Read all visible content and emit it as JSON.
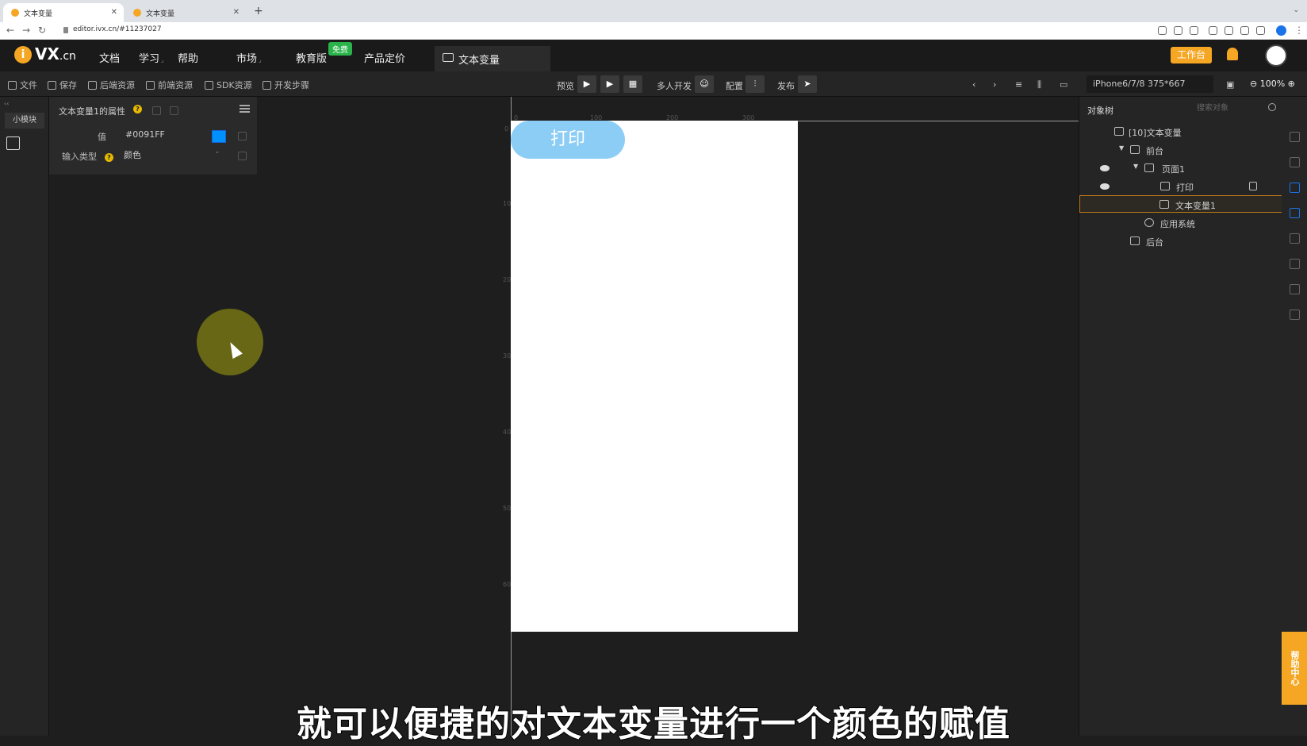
{
  "browser": {
    "tabs": [
      {
        "label": "文本变量"
      },
      {
        "label": "文本变量"
      }
    ],
    "new_tab": "+",
    "url": "editor.ivx.cn/#11237027"
  },
  "app": {
    "logo_i": "i",
    "logo_text": "VX",
    "logo_suffix": ".cn",
    "menu": {
      "docs": "文档",
      "learn": "学习",
      "help": "帮助",
      "market": "市场",
      "edu": "教育版",
      "free_badge": "免费",
      "pricing": "产品定价"
    },
    "doc_tab": "文本变量",
    "workbench": "工作台"
  },
  "toolbar": {
    "file": "文件",
    "save": "保存",
    "backend_res": "后端资源",
    "frontend_res": "前端资源",
    "sdk_res": "SDK资源",
    "dev_steps": "开发步骤",
    "preview": "预览",
    "multi_dev": "多人开发",
    "config": "配置",
    "publish": "发布",
    "device": "iPhone6/7/8 375*667",
    "zoom": "100%"
  },
  "left_rail": {
    "collapse": "‹‹",
    "widget_tab": "小模块"
  },
  "properties": {
    "title": "文本变量1的属性",
    "value_label": "值",
    "value": "#0091FF",
    "type_label": "输入类型",
    "type_value": "颜色",
    "swatch_color": "#0091FF"
  },
  "canvas": {
    "print_button": "打印",
    "ruler_h": [
      "0",
      "100",
      "200",
      "300"
    ],
    "ruler_v": [
      "0",
      "100",
      "200",
      "300",
      "400",
      "500",
      "600"
    ]
  },
  "object_tree": {
    "title": "对象树",
    "search_placeholder": "搜索对象",
    "rows": [
      {
        "label": "[10]文本变量"
      },
      {
        "label": "前台"
      },
      {
        "label": "页面1"
      },
      {
        "label": "打印"
      },
      {
        "label": "文本变量1"
      },
      {
        "label": "应用系统"
      },
      {
        "label": "后台"
      }
    ]
  },
  "help_center": "帮助中心",
  "subtitle": "就可以便捷的对文本变量进行一个颜色的赋值"
}
